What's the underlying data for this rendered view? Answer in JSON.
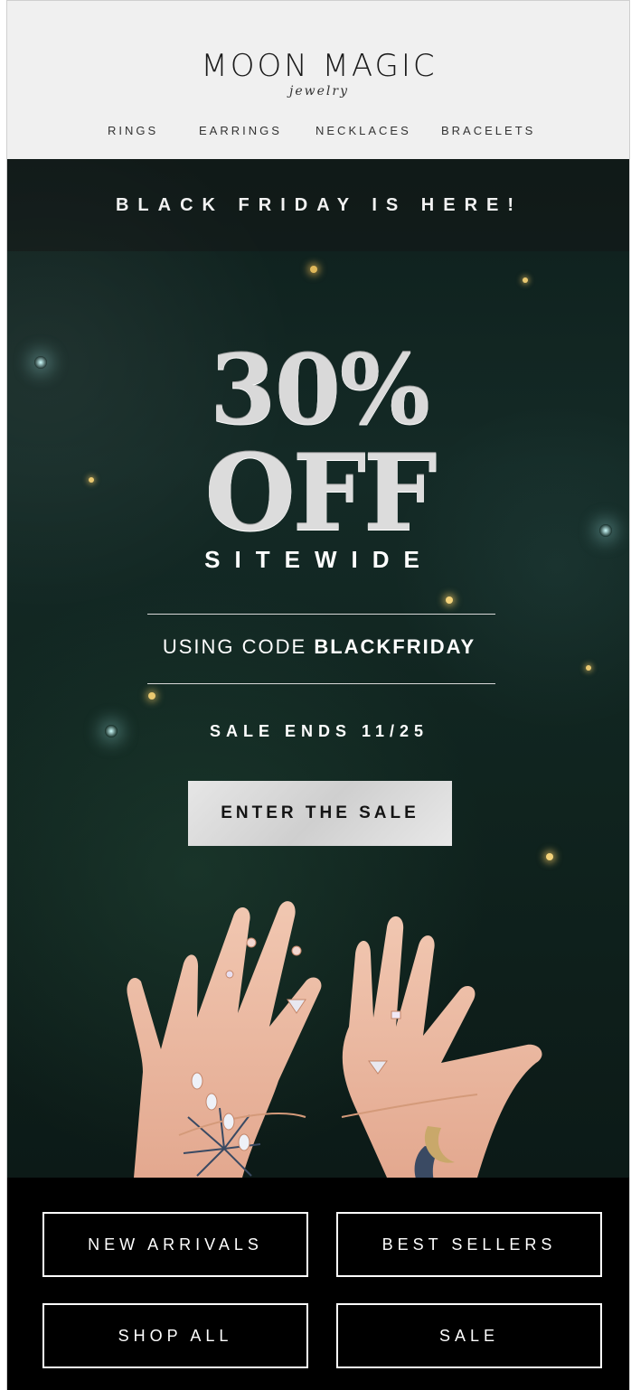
{
  "brand": {
    "name": "MOON MAGIC",
    "tagline": "jewelry"
  },
  "nav": {
    "items": [
      {
        "label": "RINGS"
      },
      {
        "label": "EARRINGS"
      },
      {
        "label": "NECKLACES"
      },
      {
        "label": "BRACELETS"
      }
    ]
  },
  "hero": {
    "banner": "BLACK FRIDAY IS HERE!",
    "discount": "30%",
    "off": "OFF",
    "scope": "SITEWIDE",
    "code_prefix": "USING CODE",
    "code": "BLACKFRIDAY",
    "sale_ends": "SALE ENDS 11/25",
    "cta_label": "ENTER THE SALE"
  },
  "footer": {
    "buttons": [
      {
        "label": "NEW ARRIVALS"
      },
      {
        "label": "BEST SELLERS"
      },
      {
        "label": "SHOP ALL"
      },
      {
        "label": "SALE"
      }
    ]
  },
  "colors": {
    "header_bg": "#f0f0f0",
    "hero_bg": "#10241f",
    "footer_bg": "#000000",
    "cta_bg": "#d9d9d9"
  }
}
